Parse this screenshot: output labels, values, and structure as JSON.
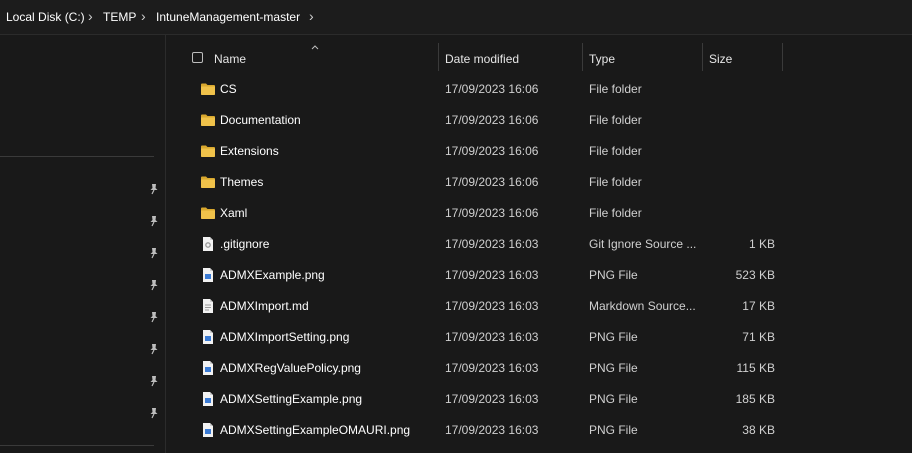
{
  "breadcrumb": {
    "items": [
      "Local Disk (C:)",
      "TEMP",
      "IntuneManagement-master"
    ]
  },
  "columns": {
    "name": "Name",
    "date_modified": "Date modified",
    "type": "Type",
    "size": "Size"
  },
  "files": [
    {
      "name": "CS",
      "date": "17/09/2023 16:06",
      "type": "File folder",
      "size": "",
      "icon": "folder-icon"
    },
    {
      "name": "Documentation",
      "date": "17/09/2023 16:06",
      "type": "File folder",
      "size": "",
      "icon": "folder-icon"
    },
    {
      "name": "Extensions",
      "date": "17/09/2023 16:06",
      "type": "File folder",
      "size": "",
      "icon": "folder-icon"
    },
    {
      "name": "Themes",
      "date": "17/09/2023 16:06",
      "type": "File folder",
      "size": "",
      "icon": "folder-icon"
    },
    {
      "name": "Xaml",
      "date": "17/09/2023 16:06",
      "type": "File folder",
      "size": "",
      "icon": "folder-icon"
    },
    {
      "name": ".gitignore",
      "date": "17/09/2023 16:03",
      "type": "Git Ignore Source ...",
      "size": "1 KB",
      "icon": "settings-file-icon"
    },
    {
      "name": "ADMXExample.png",
      "date": "17/09/2023 16:03",
      "type": "PNG File",
      "size": "523 KB",
      "icon": "image-file-icon"
    },
    {
      "name": "ADMXImport.md",
      "date": "17/09/2023 16:03",
      "type": "Markdown Source...",
      "size": "17 KB",
      "icon": "document-file-icon"
    },
    {
      "name": "ADMXImportSetting.png",
      "date": "17/09/2023 16:03",
      "type": "PNG File",
      "size": "71 KB",
      "icon": "image-file-icon"
    },
    {
      "name": "ADMXRegValuePolicy.png",
      "date": "17/09/2023 16:03",
      "type": "PNG File",
      "size": "115 KB",
      "icon": "image-file-icon"
    },
    {
      "name": "ADMXSettingExample.png",
      "date": "17/09/2023 16:03",
      "type": "PNG File",
      "size": "185 KB",
      "icon": "image-file-icon"
    },
    {
      "name": "ADMXSettingExampleOMAURI.png",
      "date": "17/09/2023 16:03",
      "type": "PNG File",
      "size": "38 KB",
      "icon": "image-file-icon"
    }
  ],
  "nav": {
    "pinned_icons": [
      "pin-icon",
      "pin-icon",
      "pin-icon",
      "pin-icon",
      "pin-icon",
      "pin-icon",
      "pin-icon",
      "pin-icon"
    ]
  },
  "colors": {
    "background": "#191919",
    "folder": "#f0c24a",
    "file_blue": "#3b7bd4"
  }
}
